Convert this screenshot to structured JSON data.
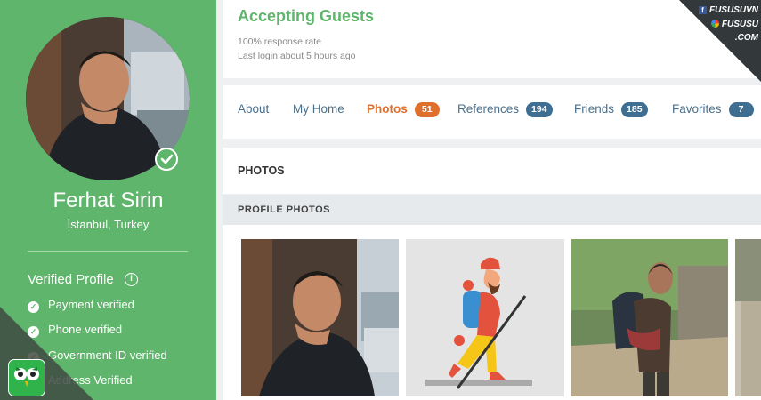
{
  "profile": {
    "name": "Ferhat Sirin",
    "location": "İstanbul, Turkey",
    "avatar_alt": "Ferhat Sirin profile photo"
  },
  "verification": {
    "title": "Verified Profile",
    "items": [
      {
        "label": "Payment verified"
      },
      {
        "label": "Phone verified"
      },
      {
        "label": "Government ID verified"
      },
      {
        "label": "Address Verified"
      }
    ]
  },
  "header": {
    "status": "Accepting Guests",
    "response_rate": "100% response rate",
    "last_login": "Last login about 5 hours ago"
  },
  "watermark": {
    "line1": "FUSUSUVN",
    "line2": "FUSUSU",
    "line3": ".COM"
  },
  "tabs": [
    {
      "label": "About"
    },
    {
      "label": "My Home"
    },
    {
      "label": "Photos",
      "count": "51"
    },
    {
      "label": "References",
      "count": "194"
    },
    {
      "label": "Friends",
      "count": "185"
    },
    {
      "label": "Favorites",
      "count": "7"
    }
  ],
  "section": {
    "title": "PHOTOS",
    "subtitle": "PROFILE PHOTOS"
  },
  "colors": {
    "sidebar_green": "#5fb56b",
    "accent_orange": "#e06f2b",
    "badge_blue": "#3f6e93",
    "link_blue": "#4a6f8a"
  }
}
